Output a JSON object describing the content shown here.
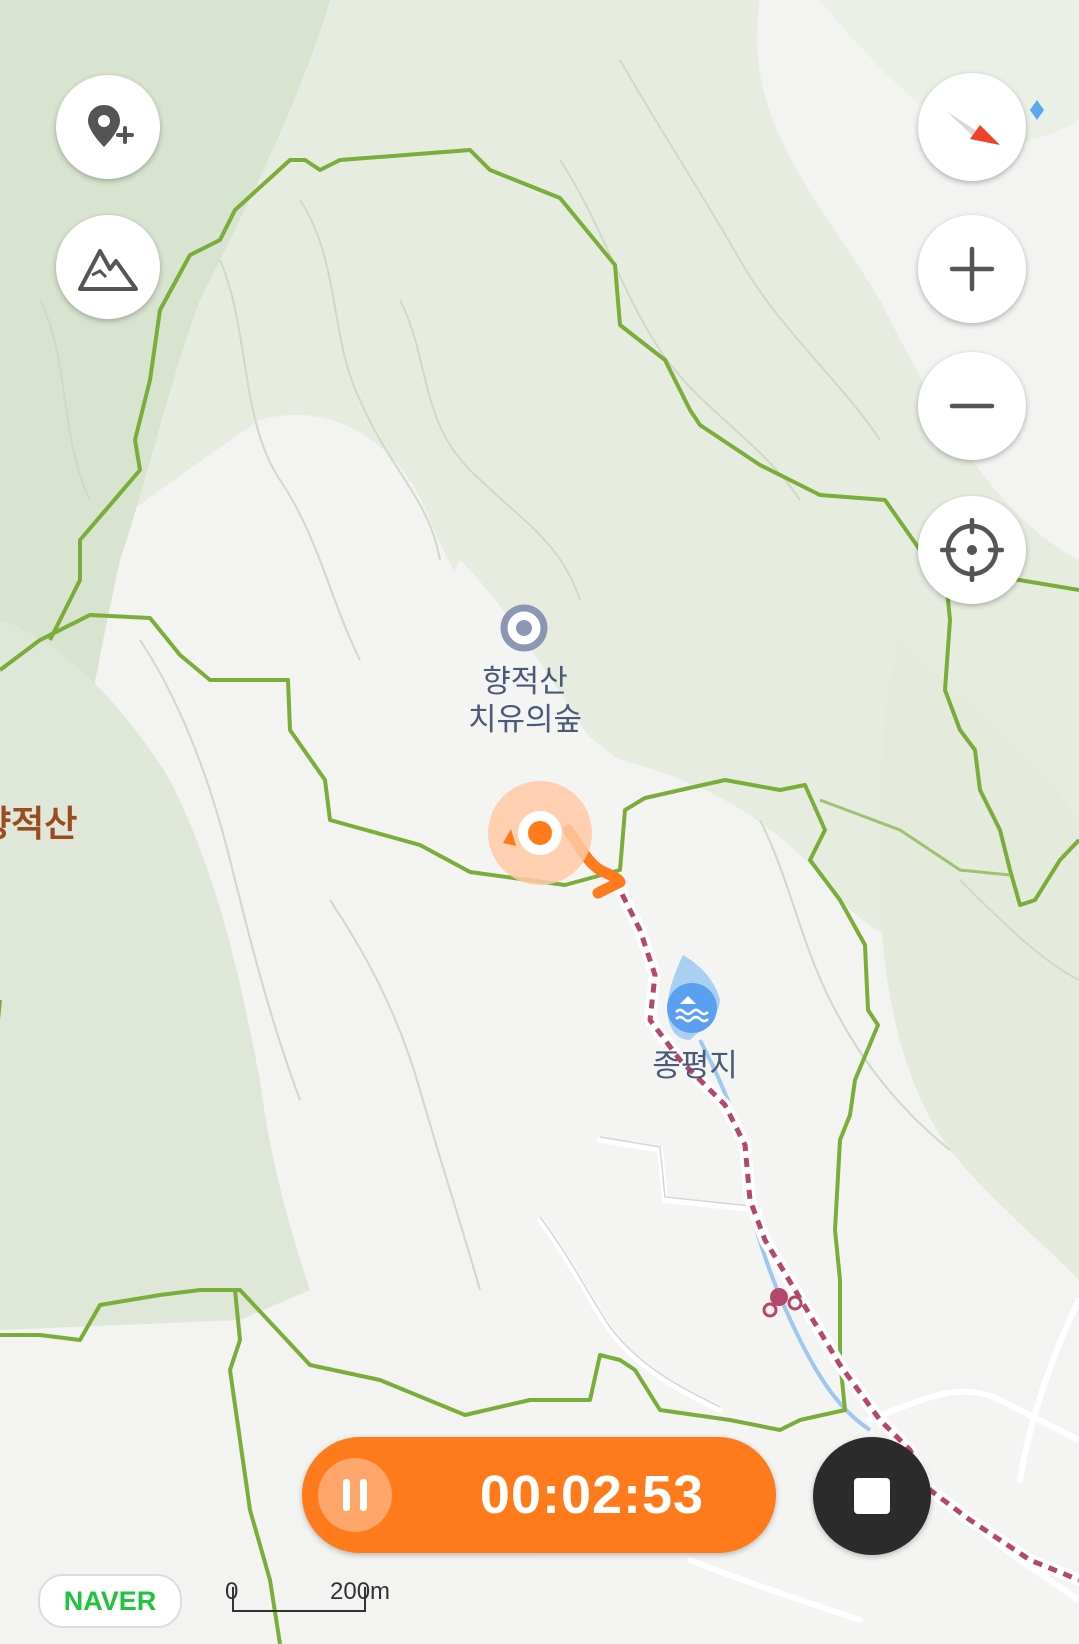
{
  "map": {
    "mountain_label": "향적산",
    "poi": {
      "line1": "향적산",
      "line2": "치유의숲"
    },
    "reservoir": "종평지",
    "colors": {
      "terrain_dark": "#d9e4d2",
      "terrain_light": "#e9efe4",
      "boundary": "#7aad3a",
      "trail": "#b5476a",
      "track": "#ff7a1a",
      "water": "#8fbfec"
    }
  },
  "controls": {
    "add_place_icon": "pin-plus-icon",
    "mountain_icon": "mountain-icon",
    "compass_icon": "compass-icon",
    "zoom_in_icon": "plus-icon",
    "zoom_out_icon": "minus-icon",
    "locate_icon": "crosshair-icon"
  },
  "recording": {
    "elapsed": "00:02:53",
    "pause_icon": "pause-icon",
    "stop_icon": "stop-icon"
  },
  "footer": {
    "logo": "NAVER",
    "scale_start": "0",
    "scale_end": "200m"
  }
}
